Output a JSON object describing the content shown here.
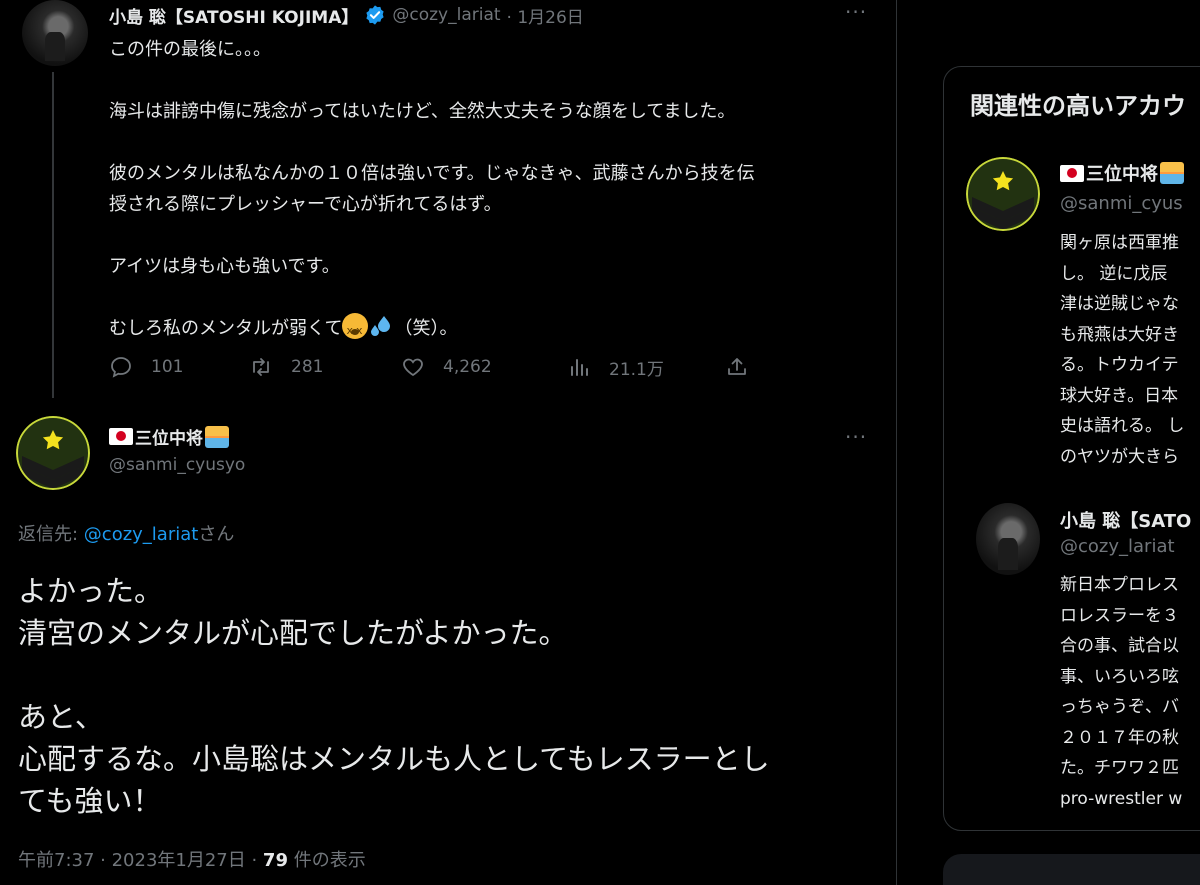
{
  "tweet1": {
    "name": "小島 聡【SATOSHI KOJIMA】",
    "handle": "@cozy_lariat",
    "date": "· 1月26日",
    "more": "···",
    "lines": [
      "この件の最後に。。。",
      "",
      "海斗は誹謗中傷に残念がってはいたけど、全然大丈夫そうな顔をしてました。",
      "",
      "彼のメンタルは私なんかの１０倍は強いです。じゃなきゃ、武藤さんから技を伝",
      "授される際にプレッシャーで心が折れてるはず。",
      "",
      "アイツは身も心も強いです。",
      ""
    ],
    "last_line_prefix": "むしろ私のメンタルが弱くて",
    "last_line_suffix": "（笑）。",
    "replies": "101",
    "retweets": "281",
    "likes": "4,262",
    "views": "21.1万"
  },
  "tweet2": {
    "name": "三位中将",
    "handle": "@sanmi_cyusyo",
    "more": "···",
    "reply_label": "返信先: ",
    "reply_handle": "@cozy_lariat",
    "reply_suffix": "さん",
    "lines": [
      "よかった。",
      "清宮のメンタルが心配でしたがよかった。",
      "",
      "あと、",
      "心配するな。小島聡はメンタルも人としてもレスラーとし",
      "ても強い！"
    ],
    "time": "午前7:37 · 2023年1月27日 · ",
    "view_count": "79",
    "view_label": " 件の表示"
  },
  "sidebar": {
    "title": "関連性の高いアカウ",
    "accounts": [
      {
        "name": "三位中将",
        "handle": "@sanmi_cyus",
        "bio": [
          "関ヶ原は西軍推",
          "し。 逆に戊辰",
          "津は逆賊じゃな",
          "も飛燕は大好き",
          "る。トウカイテ",
          "球大好き。日本",
          "史は語れる。 し",
          "のヤツが大きら"
        ]
      },
      {
        "name": "小島 聡【SATO",
        "handle": "@cozy_lariat",
        "bio": [
          "新日本プロレス",
          "ロレスラーを３",
          "合の事、試合以",
          "事、いろいろ呟",
          "っちゃうぞ、バ",
          "２０１７年の秋",
          "た。チワワ２匹",
          "pro-wrestler w"
        ]
      }
    ]
  },
  "colors": {
    "background": "#000000",
    "text": "#e7e9ea",
    "muted": "#71767b",
    "link": "#1d9bf0",
    "border": "#2f3336"
  }
}
